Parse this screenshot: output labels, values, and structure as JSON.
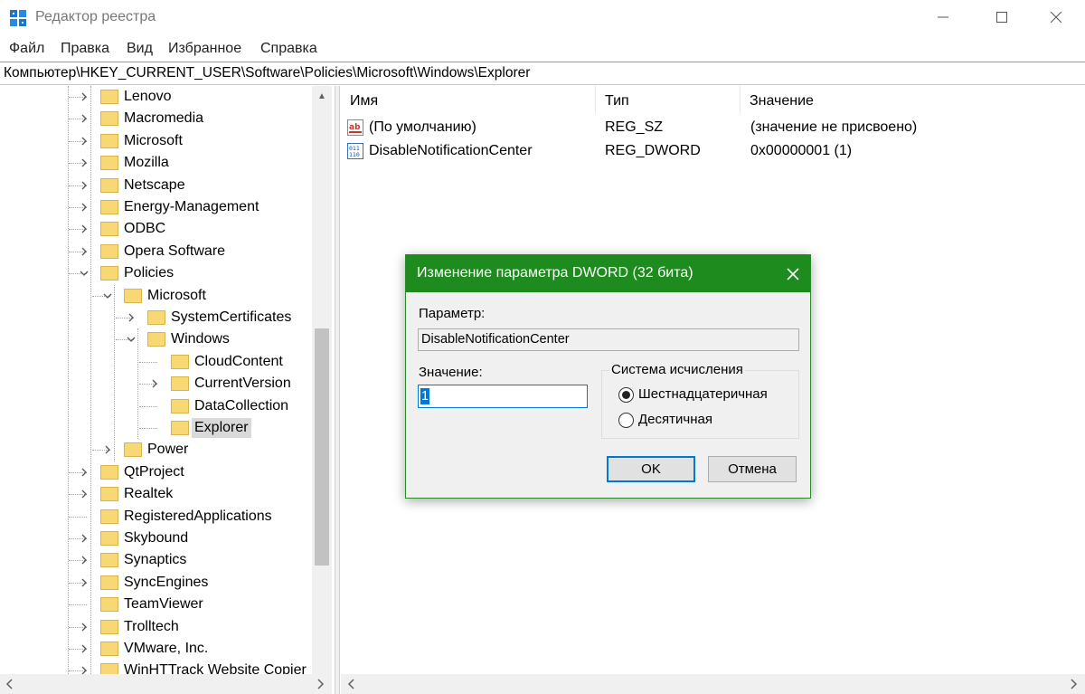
{
  "window": {
    "title": "Редактор реестра",
    "controls": {
      "minimize": "—",
      "maximize": "☐",
      "close": "✕"
    }
  },
  "menu": [
    "Файл",
    "Правка",
    "Вид",
    "Избранное",
    "Справка"
  ],
  "address": "Компьютер\\HKEY_CURRENT_USER\\Software\\Policies\\Microsoft\\Windows\\Explorer",
  "tree": [
    {
      "label": "Lenovo",
      "level": 0,
      "expander": "collapsed"
    },
    {
      "label": "Macromedia",
      "level": 0,
      "expander": "collapsed"
    },
    {
      "label": "Microsoft",
      "level": 0,
      "expander": "collapsed"
    },
    {
      "label": "Mozilla",
      "level": 0,
      "expander": "collapsed"
    },
    {
      "label": "Netscape",
      "level": 0,
      "expander": "collapsed"
    },
    {
      "label": "Energy-Management",
      "level": 0,
      "expander": "collapsed"
    },
    {
      "label": "ODBC",
      "level": 0,
      "expander": "collapsed"
    },
    {
      "label": "Opera Software",
      "level": 0,
      "expander": "collapsed"
    },
    {
      "label": "Policies",
      "level": 0,
      "expander": "expanded"
    },
    {
      "label": "Microsoft",
      "level": 1,
      "expander": "expanded"
    },
    {
      "label": "SystemCertificates",
      "level": 2,
      "expander": "collapsed"
    },
    {
      "label": "Windows",
      "level": 2,
      "expander": "expanded"
    },
    {
      "label": "CloudContent",
      "level": 3,
      "expander": "none"
    },
    {
      "label": "CurrentVersion",
      "level": 3,
      "expander": "collapsed"
    },
    {
      "label": "DataCollection",
      "level": 3,
      "expander": "none"
    },
    {
      "label": "Explorer",
      "level": 3,
      "expander": "none",
      "selected": true
    },
    {
      "label": "Power",
      "level": 1,
      "expander": "collapsed"
    },
    {
      "label": "QtProject",
      "level": 0,
      "expander": "collapsed"
    },
    {
      "label": "Realtek",
      "level": 0,
      "expander": "collapsed"
    },
    {
      "label": "RegisteredApplications",
      "level": 0,
      "expander": "none"
    },
    {
      "label": "Skybound",
      "level": 0,
      "expander": "collapsed"
    },
    {
      "label": "Synaptics",
      "level": 0,
      "expander": "collapsed"
    },
    {
      "label": "SyncEngines",
      "level": 0,
      "expander": "collapsed"
    },
    {
      "label": "TeamViewer",
      "level": 0,
      "expander": "none"
    },
    {
      "label": "Trolltech",
      "level": 0,
      "expander": "collapsed"
    },
    {
      "label": "VMware, Inc.",
      "level": 0,
      "expander": "collapsed"
    },
    {
      "label": "WinHTTrack Website Copier",
      "level": 0,
      "expander": "collapsed"
    }
  ],
  "values_table": {
    "columns": [
      "Имя",
      "Тип",
      "Значение"
    ],
    "rows": [
      {
        "icon": "string-value-icon",
        "name": "(По умолчанию)",
        "type": "REG_SZ",
        "data": "(значение не присвоено)"
      },
      {
        "icon": "binary-value-icon",
        "name": "DisableNotificationCenter",
        "type": "REG_DWORD",
        "data": "0x00000001 (1)"
      }
    ]
  },
  "dialog": {
    "title": "Изменение параметра DWORD (32 бита)",
    "param_label": "Параметр:",
    "param_value": "DisableNotificationCenter",
    "value_label": "Значение:",
    "value": "1",
    "radix_label": "Система исчисления",
    "radix_options": [
      {
        "label": "Шестнадцатеричная",
        "checked": true
      },
      {
        "label": "Десятичная",
        "checked": false
      }
    ],
    "ok": "OK",
    "cancel": "Отмена"
  },
  "colors": {
    "dialog_titlebar": "#1e8b1e",
    "selection": "#0078d7",
    "folder": "#f8d775"
  }
}
